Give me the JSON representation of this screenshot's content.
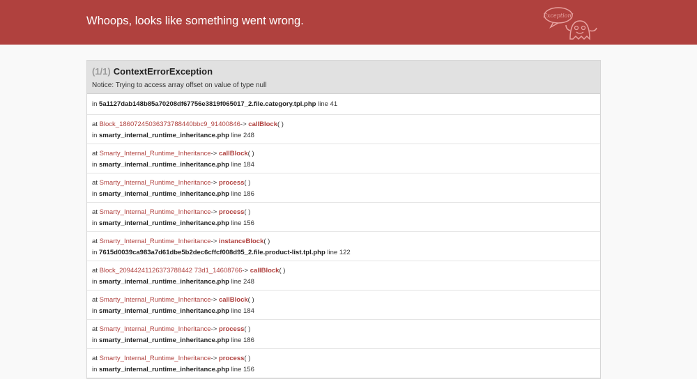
{
  "header": {
    "title": "Whoops, looks like something went wrong.",
    "logo_text": "Exception!",
    "logo_icon": "ghost-icon",
    "color": "#b0413e"
  },
  "exception": {
    "count": "(1/1)",
    "name": "ContextErrorException",
    "message": "Notice: Trying to access array offset on value of type null"
  },
  "trace": [
    {
      "kind": "in",
      "file": "5a1127dab148b85a70208df67756e3819f065017_2.file.category.tpl.php",
      "line": "line 41"
    },
    {
      "kind": "at",
      "cls": "Block_18607245036373788440bbc9_91400846",
      "fn": "callBlock",
      "file": "smarty_internal_runtime_inheritance.php",
      "line": "line 248"
    },
    {
      "kind": "at",
      "cls": "Smarty_Internal_Runtime_Inheritance",
      "fn": "callBlock",
      "file": "smarty_internal_runtime_inheritance.php",
      "line": "line 184"
    },
    {
      "kind": "at",
      "cls": "Smarty_Internal_Runtime_Inheritance",
      "fn": "process",
      "file": "smarty_internal_runtime_inheritance.php",
      "line": "line 186"
    },
    {
      "kind": "at",
      "cls": "Smarty_Internal_Runtime_Inheritance",
      "fn": "process",
      "file": "smarty_internal_runtime_inheritance.php",
      "line": "line 156"
    },
    {
      "kind": "at",
      "cls": "Smarty_Internal_Runtime_Inheritance",
      "fn": "instanceBlock",
      "file": "7615d0039ca983a7d61dbe5b2dec6cffcf008d95_2.file.product-list.tpl.php",
      "line": "line 122"
    },
    {
      "kind": "at",
      "cls": "Block_20944241126373788442 73d1_14608766",
      "fn": "callBlock",
      "file": "smarty_internal_runtime_inheritance.php",
      "line": "line 248"
    },
    {
      "kind": "at",
      "cls": "Smarty_Internal_Runtime_Inheritance",
      "fn": "callBlock",
      "file": "smarty_internal_runtime_inheritance.php",
      "line": "line 184"
    },
    {
      "kind": "at",
      "cls": "Smarty_Internal_Runtime_Inheritance",
      "fn": "process",
      "file": "smarty_internal_runtime_inheritance.php",
      "line": "line 186"
    },
    {
      "kind": "at",
      "cls": "Smarty_Internal_Runtime_Inheritance",
      "fn": "process",
      "file": "smarty_internal_runtime_inheritance.php",
      "line": "line 156"
    }
  ],
  "labels": {
    "at": "at",
    "in": "in",
    "arrow": "->",
    "parens": "( )"
  }
}
